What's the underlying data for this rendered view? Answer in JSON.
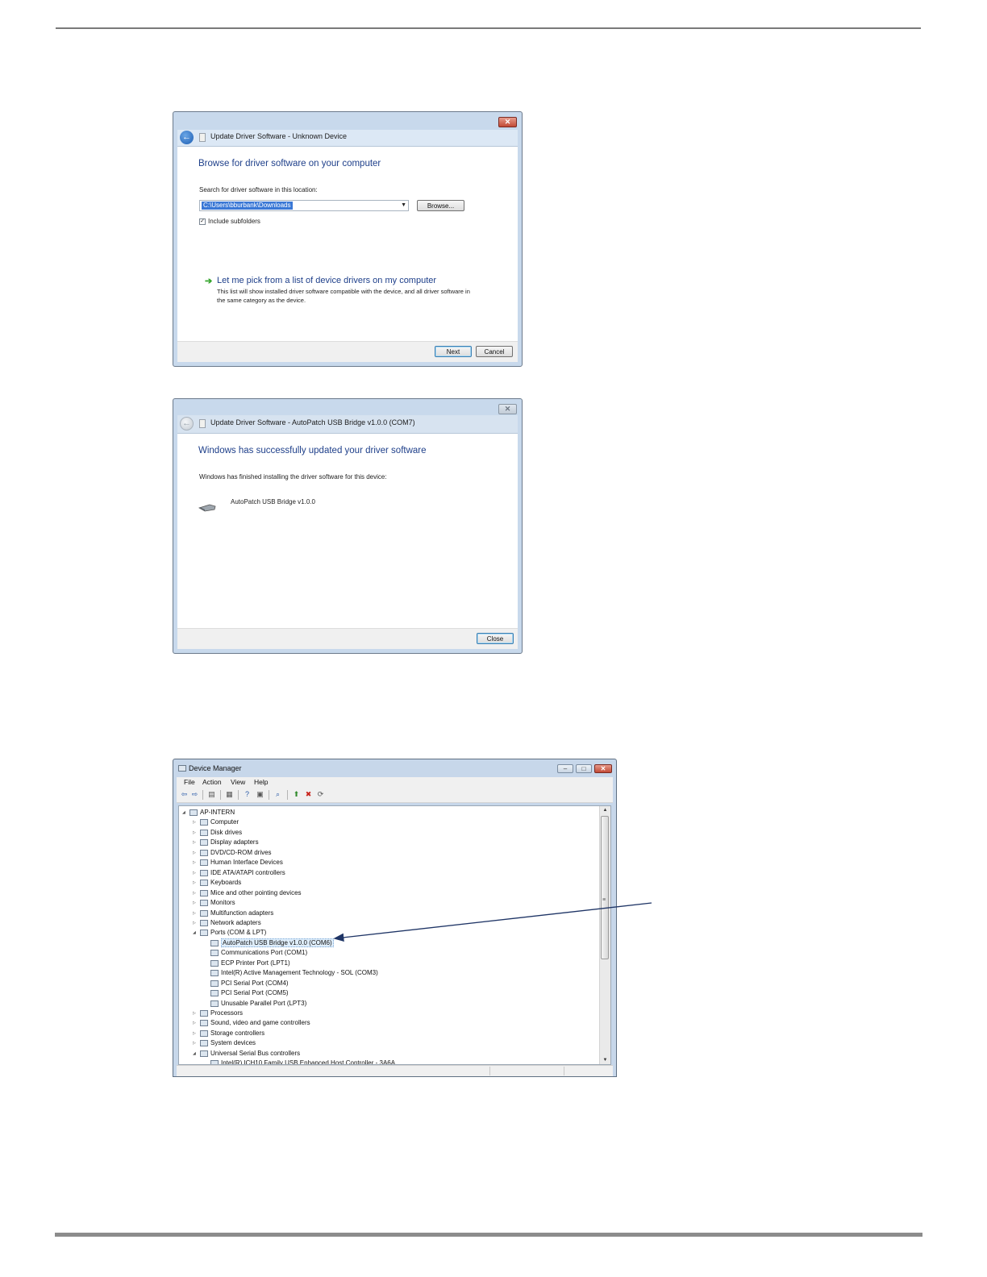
{
  "wizard1": {
    "title": "Update Driver Software - Unknown Device",
    "heading": "Browse for driver software on your computer",
    "search_label": "Search for driver software in this location:",
    "path_value": "C:\\Users\\bburbank\\Downloads",
    "browse_label": "Browse...",
    "include_subfolders_label": "Include subfolders",
    "include_subfolders_checked": true,
    "pick_title": "Let me pick from a list of device drivers on my computer",
    "pick_desc": "This list will show installed driver software compatible with the device, and all driver software in the same category as the device.",
    "next_label": "Next",
    "cancel_label": "Cancel"
  },
  "wizard2": {
    "title": "Update Driver Software - AutoPatch USB Bridge v1.0.0 (COM7)",
    "heading": "Windows has successfully updated your driver software",
    "finished_text": "Windows has finished installing the driver software for this device:",
    "device_name": "AutoPatch USB Bridge v1.0.0",
    "close_label": "Close"
  },
  "device_manager": {
    "title": "Device Manager",
    "menu": [
      "File",
      "Action",
      "View",
      "Help"
    ],
    "toolbar_icons": [
      "back-icon",
      "forward-icon",
      "show-hide-tree-icon",
      "properties-icon",
      "help-icon",
      "expand-icon",
      "scan-hardware-icon",
      "update-driver-icon",
      "uninstall-icon",
      "disable-icon"
    ],
    "tree": [
      {
        "label": "AP-INTERN",
        "level": 0,
        "expanded": true,
        "icon": "computer-root-icon"
      },
      {
        "label": "Computer",
        "level": 1,
        "icon": "computer-icon"
      },
      {
        "label": "Disk drives",
        "level": 1,
        "icon": "disk-drive-icon"
      },
      {
        "label": "Display adapters",
        "level": 1,
        "icon": "display-adapter-icon"
      },
      {
        "label": "DVD/CD-ROM drives",
        "level": 1,
        "icon": "dvd-drive-icon"
      },
      {
        "label": "Human Interface Devices",
        "level": 1,
        "icon": "hid-icon"
      },
      {
        "label": "IDE ATA/ATAPI controllers",
        "level": 1,
        "icon": "ide-controller-icon"
      },
      {
        "label": "Keyboards",
        "level": 1,
        "icon": "keyboard-icon"
      },
      {
        "label": "Mice and other pointing devices",
        "level": 1,
        "icon": "mouse-icon"
      },
      {
        "label": "Monitors",
        "level": 1,
        "icon": "monitor-icon"
      },
      {
        "label": "Multifunction adapters",
        "level": 1,
        "icon": "multifunction-adapter-icon"
      },
      {
        "label": "Network adapters",
        "level": 1,
        "icon": "network-adapter-icon"
      },
      {
        "label": "Ports (COM & LPT)",
        "level": 1,
        "expanded": true,
        "icon": "port-icon"
      },
      {
        "label": "AutoPatch USB Bridge v1.0.0 (COM6)",
        "level": 2,
        "selected": true,
        "icon": "port-icon"
      },
      {
        "label": "Communications Port (COM1)",
        "level": 2,
        "icon": "port-icon"
      },
      {
        "label": "ECP Printer Port (LPT1)",
        "level": 2,
        "icon": "port-icon"
      },
      {
        "label": "Intel(R) Active Management Technology - SOL (COM3)",
        "level": 2,
        "icon": "port-icon"
      },
      {
        "label": "PCI Serial Port (COM4)",
        "level": 2,
        "icon": "port-icon"
      },
      {
        "label": "PCI Serial Port (COM5)",
        "level": 2,
        "icon": "port-icon"
      },
      {
        "label": "Unusable Parallel Port (LPT3)",
        "level": 2,
        "icon": "port-icon"
      },
      {
        "label": "Processors",
        "level": 1,
        "icon": "processor-icon"
      },
      {
        "label": "Sound, video and game controllers",
        "level": 1,
        "icon": "sound-icon"
      },
      {
        "label": "Storage controllers",
        "level": 1,
        "icon": "storage-controller-icon"
      },
      {
        "label": "System devices",
        "level": 1,
        "icon": "system-device-icon"
      },
      {
        "label": "Universal Serial Bus controllers",
        "level": 1,
        "expanded": true,
        "icon": "usb-icon"
      },
      {
        "label": "Intel(R) ICH10 Family USB Enhanced Host Controller - 3A6A",
        "level": 2,
        "icon": "usb-icon"
      }
    ]
  },
  "colors": {
    "frame_blue": "#c8d9ec",
    "heading_blue": "#1e3f8a",
    "selection_blue": "#3a78d6",
    "green_arrow": "#35a52c",
    "annotation_line": "#1f3566"
  }
}
